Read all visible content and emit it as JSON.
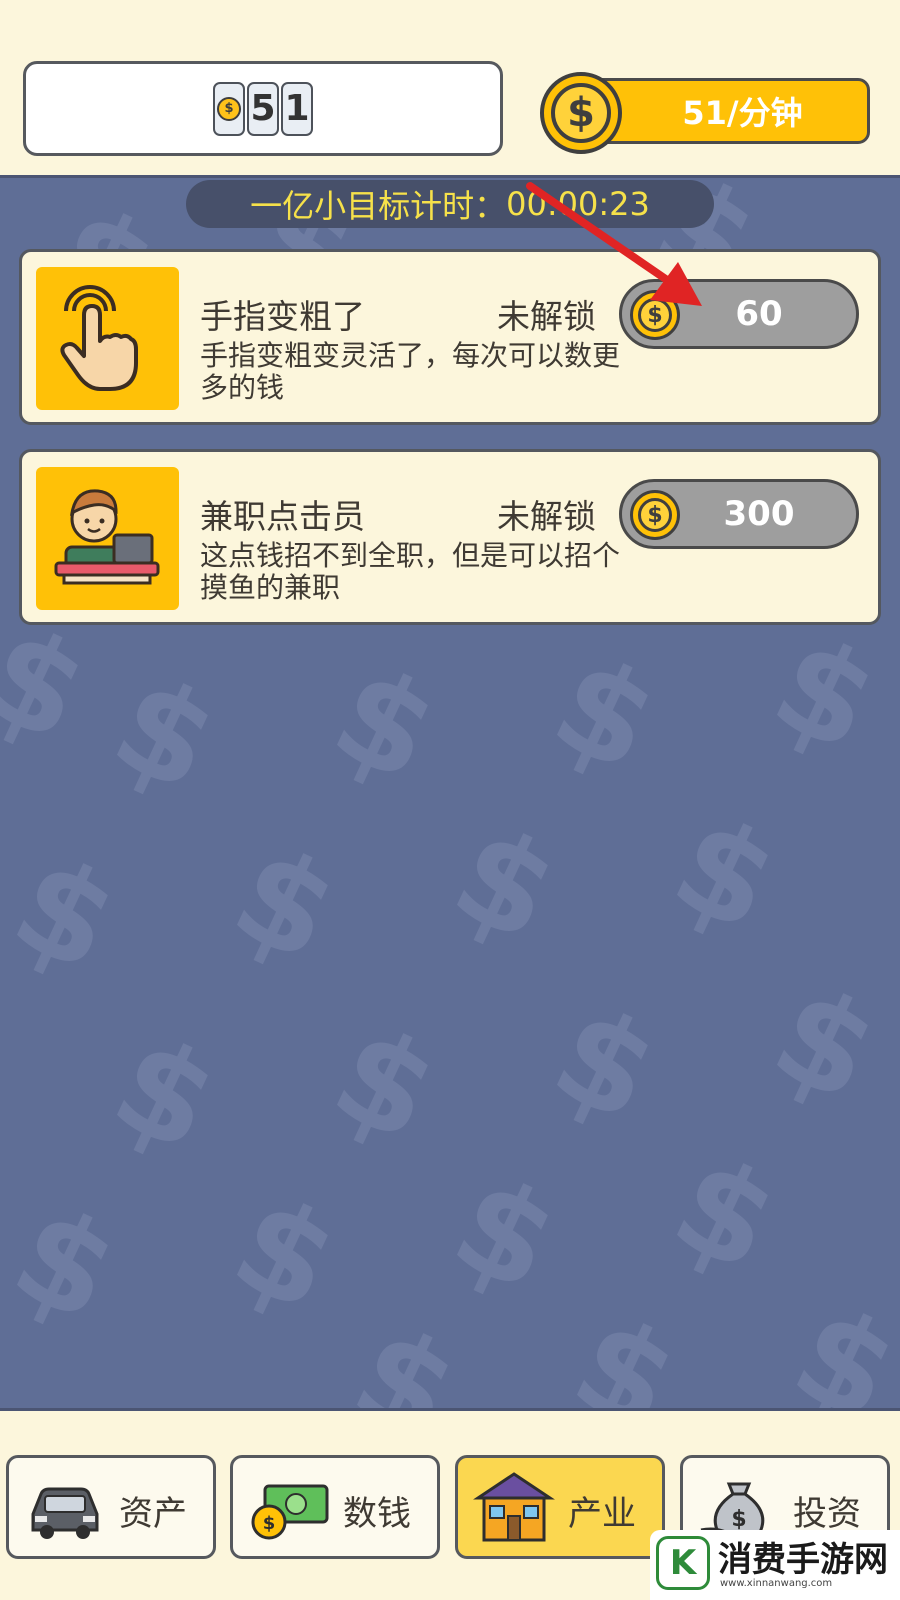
{
  "header": {
    "coin_count_digits": [
      "5",
      "1"
    ],
    "rate_text": "51/分钟",
    "rate_icon": "dollar-coin-icon"
  },
  "timer": {
    "label": "一亿小目标计时：",
    "value": "00:00:23"
  },
  "upgrades": [
    {
      "title": "手指变粗了",
      "status": "未解锁",
      "description": "手指变粗变灵活了，每次可以数更多的钱",
      "price": "60",
      "icon": "tapping-finger-icon"
    },
    {
      "title": "兼职点击员",
      "status": "未解锁",
      "description": "这点钱招不到全职，但是可以招个摸鱼的兼职",
      "price": "300",
      "icon": "office-worker-icon"
    }
  ],
  "nav": {
    "items": [
      {
        "label": "资产",
        "icon": "car-icon"
      },
      {
        "label": "数钱",
        "icon": "cash-icon"
      },
      {
        "label": "产业",
        "icon": "house-icon"
      },
      {
        "label": "投资",
        "icon": "money-bag-icon"
      }
    ],
    "active_index": 2
  },
  "watermark": {
    "text": "消费手游网",
    "url": "www.xinnanwang.com"
  },
  "colors": {
    "background": "#5f6e96",
    "panel": "#fcf6dc",
    "accent": "#ffc107",
    "timer_text": "#f6e14a",
    "arrow": "#e02424"
  }
}
